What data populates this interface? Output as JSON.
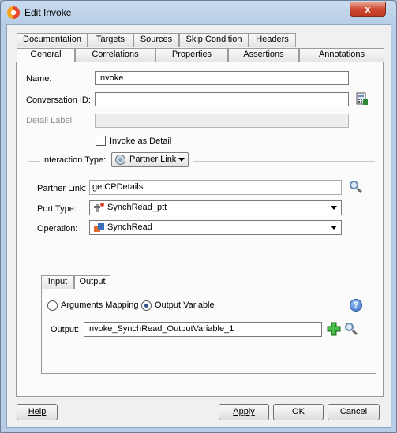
{
  "window": {
    "title": "Edit Invoke",
    "close_glyph": "x"
  },
  "tabs_row1": [
    {
      "label": "Documentation"
    },
    {
      "label": "Targets"
    },
    {
      "label": "Sources"
    },
    {
      "label": "Skip Condition"
    },
    {
      "label": "Headers"
    }
  ],
  "tabs_row2": [
    {
      "label": "General",
      "active": true
    },
    {
      "label": "Correlations"
    },
    {
      "label": "Properties"
    },
    {
      "label": "Assertions"
    },
    {
      "label": "Annotations"
    }
  ],
  "general": {
    "name": {
      "label": "Name:",
      "value": "Invoke"
    },
    "conversation_id": {
      "label": "Conversation ID:",
      "value": ""
    },
    "detail_label": {
      "label": "Detail Label:",
      "value": ""
    },
    "invoke_as_detail": {
      "label": "Invoke as Detail",
      "checked": false
    },
    "interaction_type": {
      "label": "Interaction Type:",
      "value": "Partner Link"
    },
    "partner_link": {
      "label": "Partner Link:",
      "value": "getCPDetails"
    },
    "port_type": {
      "label": "Port Type:",
      "value": "SynchRead_ptt"
    },
    "operation": {
      "label": "Operation:",
      "value": "SynchRead"
    }
  },
  "io_tabs": [
    {
      "label": "Input"
    },
    {
      "label": "Output",
      "active": true
    }
  ],
  "output_panel": {
    "arguments_mapping": "Arguments Mapping",
    "output_variable": "Output Variable",
    "selected": "Output Variable",
    "output_label": "Output:",
    "output_value": "Invoke_SynchRead_OutputVariable_1",
    "help_glyph": "?"
  },
  "footer": {
    "help": "Help",
    "apply": "Apply",
    "ok": "OK",
    "cancel": "Cancel"
  },
  "colors": {
    "title_bar": "#b7cde6",
    "close_button": "#c0391f",
    "panel_background": "#fbfbfb",
    "add_icon": "#2ea42e"
  }
}
